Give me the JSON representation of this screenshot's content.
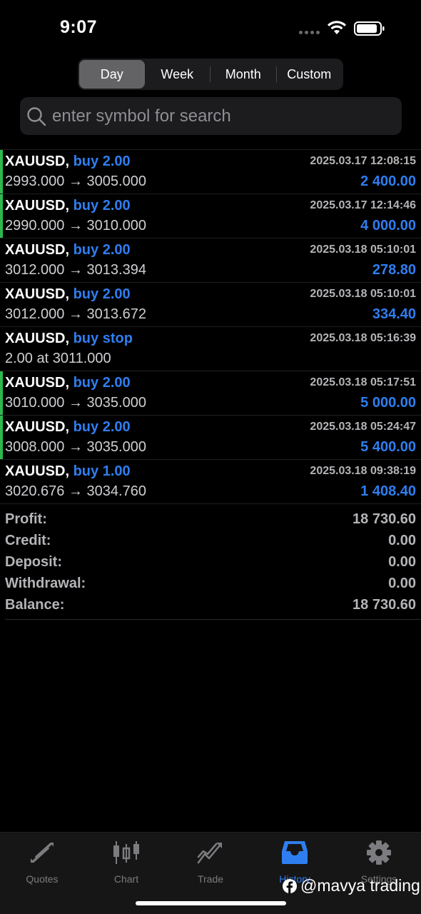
{
  "status_bar": {
    "time": "9:07"
  },
  "segments": [
    {
      "label": "Day",
      "active": true
    },
    {
      "label": "Week",
      "active": false
    },
    {
      "label": "Month",
      "active": false
    },
    {
      "label": "Custom",
      "active": false
    }
  ],
  "search": {
    "placeholder": "enter symbol for search",
    "value": ""
  },
  "deals": [
    {
      "symbol": "XAUUSD,",
      "type": "buy 2.00",
      "time": "2025.03.17 12:08:15",
      "prices": "2993.000 → 3005.000",
      "profit": "2 400.00",
      "marked": true
    },
    {
      "symbol": "XAUUSD,",
      "type": "buy 2.00",
      "time": "2025.03.17 12:14:46",
      "prices": "2990.000 → 3010.000",
      "profit": "4 000.00",
      "marked": true
    },
    {
      "symbol": "XAUUSD,",
      "type": "buy 2.00",
      "time": "2025.03.18 05:10:01",
      "prices": "3012.000 → 3013.394",
      "profit": "278.80",
      "marked": false
    },
    {
      "symbol": "XAUUSD,",
      "type": "buy 2.00",
      "time": "2025.03.18 05:10:01",
      "prices": "3012.000 → 3013.672",
      "profit": "334.40",
      "marked": false
    },
    {
      "symbol": "XAUUSD,",
      "type": "buy stop",
      "time": "2025.03.18 05:16:39",
      "prices": "2.00 at 3011.000",
      "profit": "",
      "marked": false
    },
    {
      "symbol": "XAUUSD,",
      "type": "buy 2.00",
      "time": "2025.03.18 05:17:51",
      "prices": "3010.000 → 3035.000",
      "profit": "5 000.00",
      "marked": true
    },
    {
      "symbol": "XAUUSD,",
      "type": "buy 2.00",
      "time": "2025.03.18 05:24:47",
      "prices": "3008.000 → 3035.000",
      "profit": "5 400.00",
      "marked": true
    },
    {
      "symbol": "XAUUSD,",
      "type": "buy 1.00",
      "time": "2025.03.18 09:38:19",
      "prices": "3020.676 → 3034.760",
      "profit": "1 408.40",
      "marked": false
    }
  ],
  "summary": [
    {
      "label": "Profit:",
      "value": "18 730.60"
    },
    {
      "label": "Credit:",
      "value": "0.00"
    },
    {
      "label": "Deposit:",
      "value": "0.00"
    },
    {
      "label": "Withdrawal:",
      "value": "0.00"
    },
    {
      "label": "Balance:",
      "value": "18 730.60"
    }
  ],
  "tabs": [
    {
      "label": "Quotes",
      "icon": "quotes-icon",
      "active": false
    },
    {
      "label": "Chart",
      "icon": "candlestick-icon",
      "active": false
    },
    {
      "label": "Trade",
      "icon": "trade-icon",
      "active": false
    },
    {
      "label": "History",
      "icon": "inbox-icon",
      "active": true
    },
    {
      "label": "Settings",
      "icon": "gear-icon",
      "active": false
    }
  ],
  "watermark": {
    "text": "@mavya trading"
  },
  "colors": {
    "accent": "#2f7ef0",
    "marker": "#2db84d",
    "background": "#000000"
  }
}
